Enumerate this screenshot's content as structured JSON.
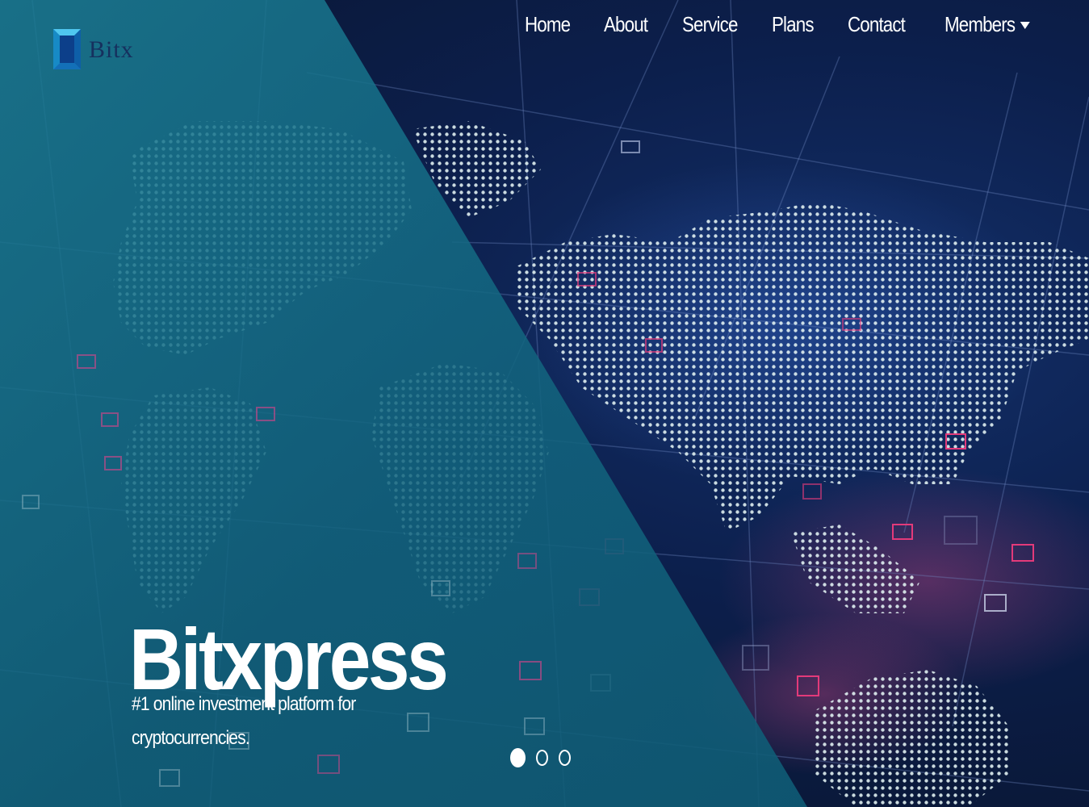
{
  "brand": {
    "logo_text": "Bitx",
    "logo_icon": "cube-logo-icon",
    "accent_color": "#1aa3d6"
  },
  "nav": {
    "items": [
      {
        "label": "Home"
      },
      {
        "label": "About"
      },
      {
        "label": "Service"
      },
      {
        "label": "Plans"
      },
      {
        "label": "Contact"
      },
      {
        "label": "Members",
        "icon": "caret-down-icon"
      }
    ]
  },
  "hero": {
    "title": "Bitxpress",
    "tagline": "#1 online investment platform for cryptocurrencies.",
    "overlay_color": "#12647e",
    "background_color": "#0b1a3a"
  },
  "carousel": {
    "slides": 3,
    "active_index": 0
  }
}
